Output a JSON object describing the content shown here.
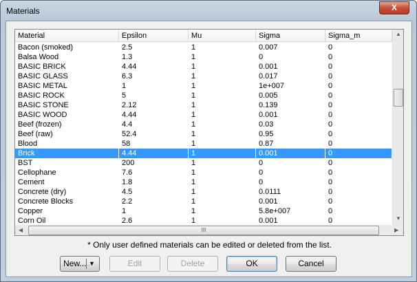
{
  "window": {
    "title": "Materials",
    "close_label": "X"
  },
  "table": {
    "columns": [
      "Material",
      "Epsilon",
      "Mu",
      "Sigma",
      "Sigma_m"
    ],
    "rows": [
      [
        "Bacon (smoked)",
        "2.5",
        "1",
        "0.007",
        "0"
      ],
      [
        "Balsa Wood",
        "1.3",
        "1",
        "0",
        "0"
      ],
      [
        "BASIC BRICK",
        "4.44",
        "1",
        "0.001",
        "0"
      ],
      [
        "BASIC GLASS",
        "6.3",
        "1",
        "0.017",
        "0"
      ],
      [
        "BASIC METAL",
        "1",
        "1",
        "1e+007",
        "0"
      ],
      [
        "BASIC ROCK",
        "5",
        "1",
        "0.005",
        "0"
      ],
      [
        "BASIC STONE",
        "2.12",
        "1",
        "0.139",
        "0"
      ],
      [
        "BASIC WOOD",
        "4.44",
        "1",
        "0.001",
        "0"
      ],
      [
        "Beef (frozen)",
        "4.4",
        "1",
        "0.03",
        "0"
      ],
      [
        "Beef (raw)",
        "52.4",
        "1",
        "0.95",
        "0"
      ],
      [
        "Blood",
        "58",
        "1",
        "0.87",
        "0"
      ],
      [
        "Brick",
        "4.44",
        "1",
        "0.001",
        "0"
      ],
      [
        "BST",
        "200",
        "1",
        "0",
        "0"
      ],
      [
        "Cellophane",
        "7.6",
        "1",
        "0",
        "0"
      ],
      [
        "Cement",
        "1.8",
        "1",
        "0",
        "0"
      ],
      [
        "Concrete (dry)",
        "4.5",
        "1",
        "0.0111",
        "0"
      ],
      [
        "Concrete Blocks",
        "2.2",
        "1",
        "0.001",
        "0"
      ],
      [
        "Copper",
        "1",
        "1",
        "5.8e+007",
        "0"
      ],
      [
        "Corn Oil",
        "2.6",
        "1",
        "0.001",
        "0"
      ]
    ],
    "selected_index": 11,
    "hscroll_grip": "III"
  },
  "note": "* Only user defined materials can be edited or deleted from the list.",
  "buttons": {
    "new": "New...",
    "edit": "Edit",
    "delete": "Delete",
    "ok": "OK",
    "cancel": "Cancel"
  }
}
